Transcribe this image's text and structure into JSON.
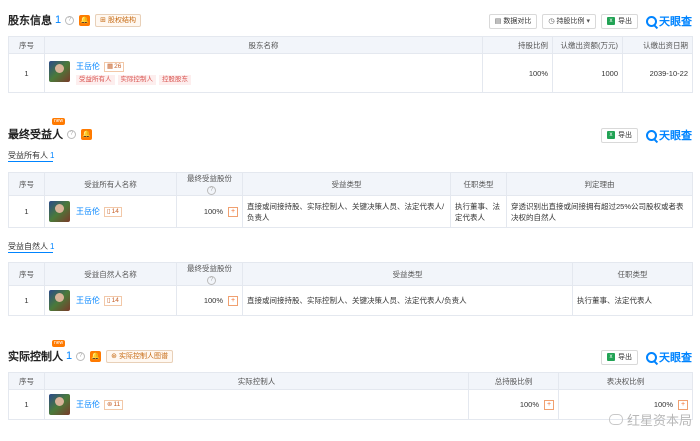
{
  "shareholders": {
    "title": "股东信息",
    "count": "1",
    "equity_structure_label": "股权结构",
    "tools": {
      "data_compare": "数据对比",
      "holding_ratio": "持股比例",
      "export": "导出"
    },
    "brand": "天眼查",
    "columns": [
      "序号",
      "股东名称",
      "持股比例",
      "认缴出资额(万元)",
      "认缴出资日期"
    ],
    "rows": [
      {
        "index": "1",
        "name": "王岳伦",
        "tag_count": "26",
        "roles": [
          "受益所有人",
          "实际控制人",
          "控股股东"
        ],
        "ratio": "100%",
        "amount": "1000",
        "date": "2039-10-22"
      }
    ]
  },
  "ultimate_beneficiary": {
    "title": "最终受益人",
    "export": "导出",
    "brand": "天眼查",
    "sub_owner": {
      "label": "受益所有人",
      "count": "1",
      "columns": [
        "序号",
        "受益所有人名称",
        "最终受益股份",
        "受益类型",
        "任职类型",
        "判定理由"
      ],
      "rows": [
        {
          "index": "1",
          "name": "王岳伦",
          "tag_count": "14",
          "share": "100%",
          "benefit_type": "直接或间接持股、实际控制人、关键决策人员、法定代表人/负责人",
          "position": "执行董事、法定代表人",
          "reason": "穿透识别出直接或间接拥有超过25%公司股权或者表决权的自然人"
        }
      ]
    },
    "sub_natural": {
      "label": "受益自然人",
      "count": "1",
      "columns": [
        "序号",
        "受益自然人名称",
        "最终受益股份",
        "受益类型",
        "任职类型"
      ],
      "rows": [
        {
          "index": "1",
          "name": "王岳伦",
          "tag_count": "14",
          "share": "100%",
          "benefit_type": "直接或间接持股、实际控制人、关键决策人员、法定代表人/负责人",
          "position": "执行董事、法定代表人"
        }
      ]
    }
  },
  "actual_controller": {
    "title": "实际控制人",
    "count": "1",
    "map_label": "实际控制人图谱",
    "export": "导出",
    "brand": "天眼查",
    "columns": [
      "序号",
      "实际控制人",
      "总持股比例",
      "表决权比例"
    ],
    "rows": [
      {
        "index": "1",
        "name": "王岳伦",
        "tag_count": "11",
        "total_ratio": "100%",
        "vote_ratio": "100%"
      }
    ]
  },
  "watermark": "红星资本局"
}
